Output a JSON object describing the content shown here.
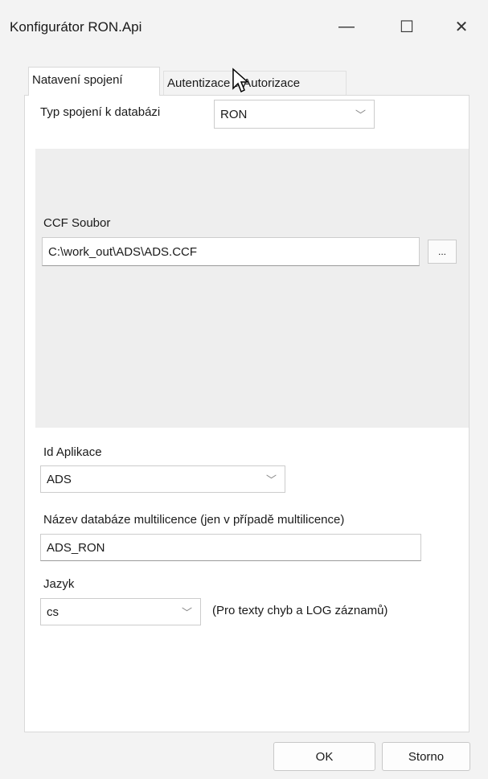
{
  "window": {
    "title": "Konfigurátor RON.Api",
    "minimize": "—",
    "maximize": "☐",
    "close": "✕"
  },
  "tabs": [
    {
      "label": "Natavení spojení",
      "active": true
    },
    {
      "label": "Autentizace a Autorizace",
      "active": false
    }
  ],
  "connection": {
    "type_label": "Typ spojení k databázi",
    "type_value": "RON",
    "ccf_label": "CCF Soubor",
    "ccf_value": "C:\\work_out\\ADS\\ADS.CCF",
    "browse_label": "..."
  },
  "app": {
    "label": "Id Aplikace",
    "value": "ADS"
  },
  "multilicence": {
    "label": "Název databáze multilicence (jen v případě multilicence)",
    "value": "ADS_RON"
  },
  "language": {
    "label": "Jazyk",
    "value": "cs",
    "hint": "(Pro texty chyb a LOG záznamů)"
  },
  "buttons": {
    "ok": "OK",
    "cancel": "Storno"
  },
  "icons": {
    "dropdown": "chevron-down-icon"
  }
}
